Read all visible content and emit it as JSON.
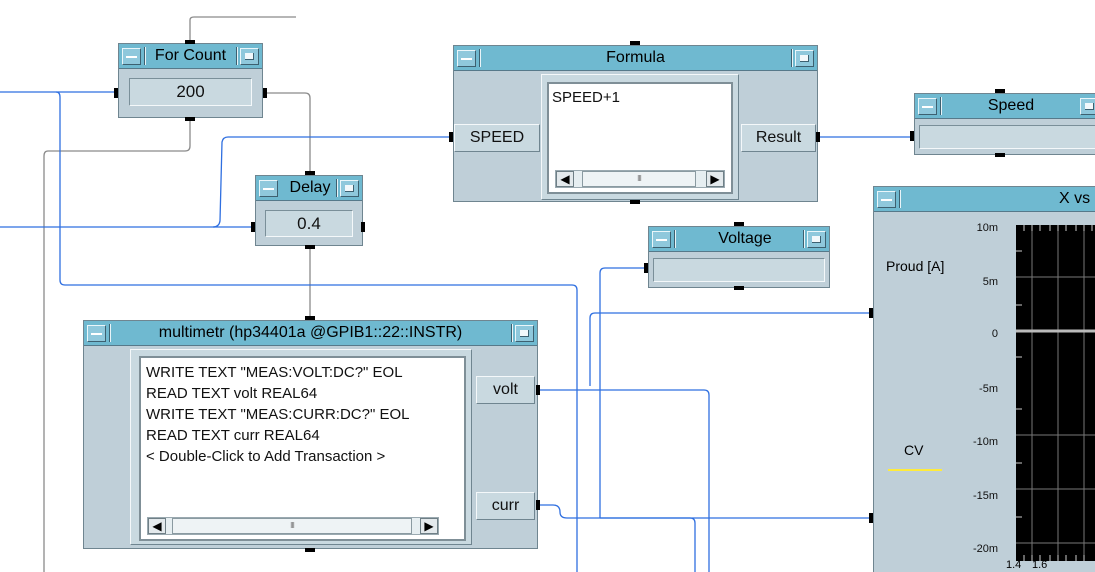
{
  "for_count": {
    "title": "For Count",
    "value": "200"
  },
  "formula": {
    "title": "Formula",
    "expression": "SPEED+1",
    "input_terminal": "SPEED",
    "output_terminal": "Result",
    "scroll_thumb": "III"
  },
  "speed": {
    "title": "Speed"
  },
  "delay": {
    "title": "Delay",
    "value": "0.4"
  },
  "voltage": {
    "title": "Voltage"
  },
  "multimeter": {
    "title": "multimetr (hp34401a @GPIB1::22::INSTR)",
    "transactions": [
      "WRITE TEXT \"MEAS:VOLT:DC?\" EOL",
      "READ TEXT volt REAL64",
      "WRITE TEXT \"MEAS:CURR:DC?\" EOL",
      "READ TEXT curr REAL64",
      "< Double-Click to Add Transaction >"
    ],
    "outputs": [
      "volt",
      "curr"
    ],
    "scroll_thumb": "III"
  },
  "xy_display": {
    "title": "X vs",
    "y_label": "Proud [A]",
    "trace_name": "CV",
    "trace_color": "#ffeb3b",
    "y_ticks": [
      "10m",
      "5m",
      "0",
      "-5m",
      "-10m",
      "-15m",
      "-20m"
    ],
    "x_ticks": [
      "1.4",
      "1.6"
    ]
  },
  "colors": {
    "wire": "#2f6fe0",
    "wire_seq": "#8a8a8a",
    "title_bar": "#6fb9d0",
    "body": "#bfcfd8"
  }
}
